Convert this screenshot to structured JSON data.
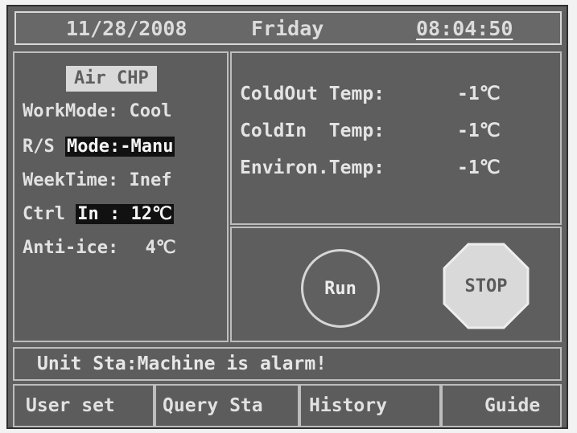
{
  "header": {
    "date": "11/28/2008",
    "day": "Friday",
    "time": "08:04:50"
  },
  "left_panel": {
    "title": "Air CHP",
    "work_mode_label": "WorkMode:",
    "work_mode_value": "Cool",
    "rs_label": "R/S",
    "rs_value": "Mode:-Manu",
    "week_time_label": "WeekTime:",
    "week_time_value": "Inef",
    "ctrl_label": "Ctrl",
    "ctrl_value": "In : 12℃",
    "anti_ice_label": "Anti-ice:",
    "anti_ice_value": "4℃"
  },
  "temps": [
    {
      "label": "ColdOut Temp:",
      "value": "-1℃"
    },
    {
      "label": "ColdIn  Temp:",
      "value": "-1℃"
    },
    {
      "label": "Environ.Temp:",
      "value": "-1℃"
    }
  ],
  "controls": {
    "run_label": "Run",
    "stop_label": "STOP"
  },
  "status": {
    "text": "Unit Sta:Machine is alarm!"
  },
  "tabs": [
    {
      "label": "User set"
    },
    {
      "label": "Query Sta"
    },
    {
      "label": "History"
    },
    {
      "label": "Guide"
    }
  ],
  "colors": {
    "screen_bg": "#5f605f",
    "border": "#bdbdbd",
    "text": "#e6e6e6",
    "stop_fill": "#d9d9d9"
  }
}
